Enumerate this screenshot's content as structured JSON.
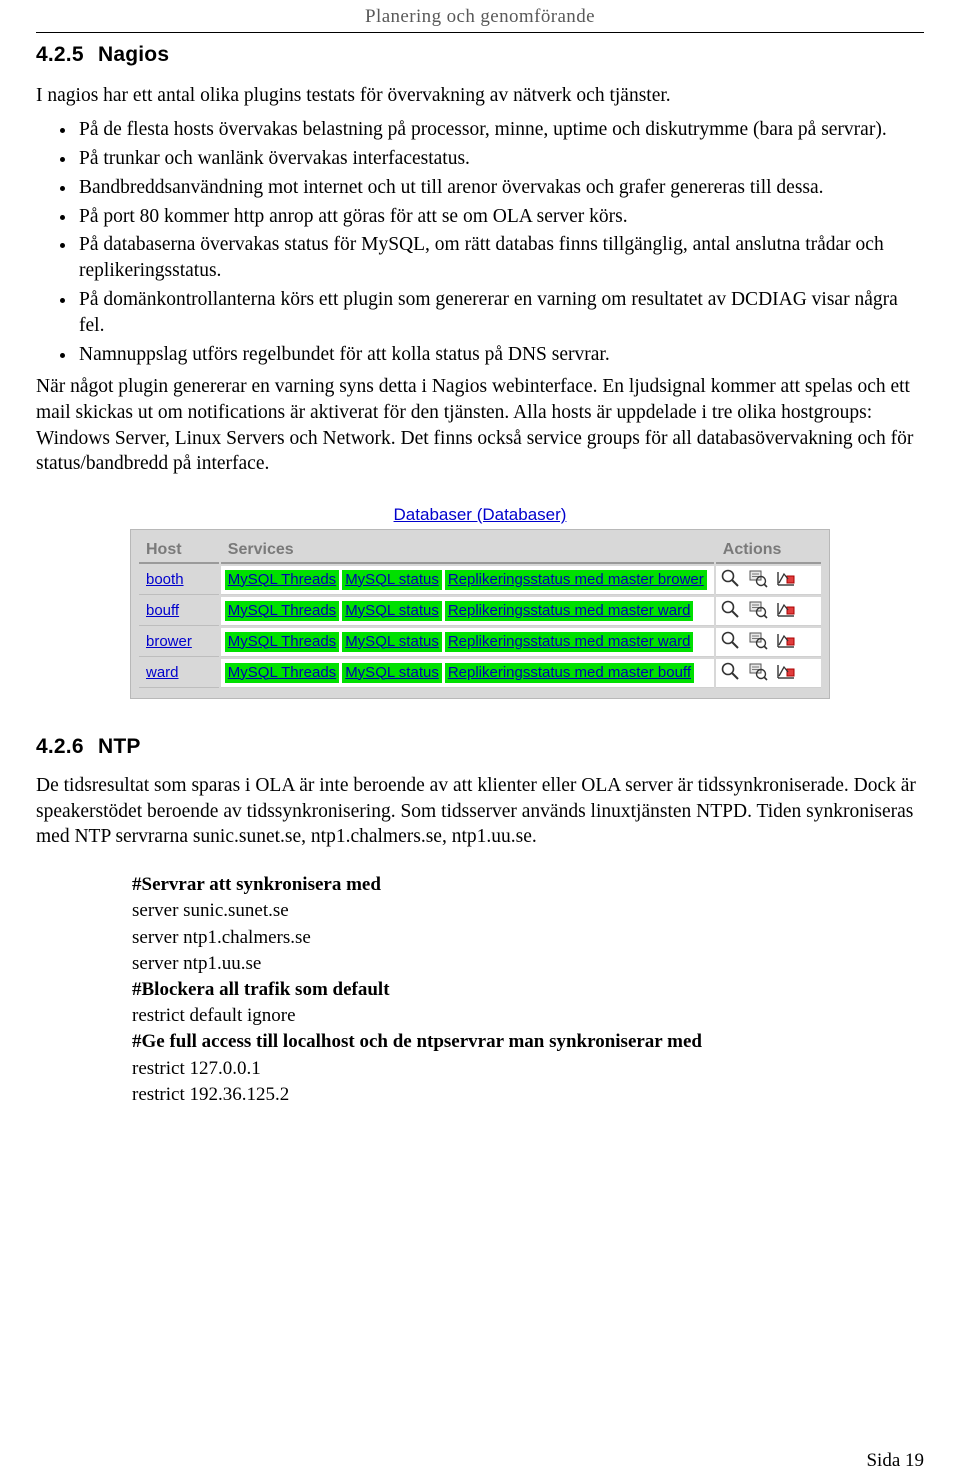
{
  "header": {
    "running_title": "Planering och genomförande"
  },
  "sections": {
    "nagios": {
      "number": "4.2.5",
      "title": "Nagios",
      "intro": "I nagios har ett antal olika plugins testats för övervakning av nätverk och tjänster.",
      "bullets": [
        "På de flesta hosts övervakas belastning på processor, minne, uptime och diskutrymme (bara på servrar).",
        "På trunkar och wanlänk övervakas interfacestatus.",
        "Bandbreddsanvändning mot internet och ut till arenor övervakas och grafer genereras till dessa.",
        "På port 80 kommer http anrop att göras för att se om OLA server körs.",
        "På databaserna övervakas status för MySQL, om rätt databas finns tillgänglig, antal anslutna trådar och replikeringsstatus.",
        "På domänkontrollanterna körs ett plugin som genererar en varning om resultatet av DCDIAG visar några fel.",
        "Namnuppslag utförs regelbundet för att kolla status på DNS servrar."
      ],
      "outro": "När något plugin genererar en varning syns detta i Nagios webinterface. En ljudsignal kommer att spelas och ett mail skickas ut om notifications är aktiverat för den tjänsten. Alla hosts är uppdelade i tre olika hostgroups: Windows Server, Linux Servers och Network. Det finns också service groups för all databasövervakning och för status/bandbredd på interface."
    },
    "ntp": {
      "number": "4.2.6",
      "title": "NTP",
      "paragraph": "De tidsresultat som sparas i OLA är inte beroende av att klienter eller OLA server är tidssynkroniserade. Dock är speakerstödet beroende av tidssynkronisering. Som tidsserver används linuxtjänsten NTPD. Tiden synkroniseras med NTP servrarna sunic.sunet.se, ntp1.chalmers.se, ntp1.uu.se.",
      "config": [
        {
          "text": "#Servrar att synkronisera med",
          "bold": true
        },
        {
          "text": "server sunic.sunet.se",
          "bold": false
        },
        {
          "text": "server ntp1.chalmers.se",
          "bold": false
        },
        {
          "text": "server ntp1.uu.se",
          "bold": false
        },
        {
          "text": "#Blockera all trafik som default",
          "bold": true
        },
        {
          "text": "restrict default ignore",
          "bold": false
        },
        {
          "text": "#Ge full access till localhost och de ntpservrar man synkroniserar med",
          "bold": true
        },
        {
          "text": "restrict 127.0.0.1",
          "bold": false
        },
        {
          "text": "restrict 192.36.125.2",
          "bold": false
        }
      ]
    }
  },
  "nagios_figure": {
    "title": "Databaser (Databaser)",
    "columns": [
      "Host",
      "Services",
      "Actions"
    ],
    "rows": [
      {
        "host": "booth",
        "services": [
          "MySQL Threads",
          "MySQL status",
          "Replikeringsstatus med master brower"
        ],
        "actions": [
          "magnifier-icon",
          "host-detail-icon",
          "trends-icon"
        ]
      },
      {
        "host": "bouff",
        "services": [
          "MySQL Threads",
          "MySQL status",
          "Replikeringsstatus med master ward"
        ],
        "actions": [
          "magnifier-icon",
          "host-detail-icon",
          "trends-icon"
        ]
      },
      {
        "host": "brower",
        "services": [
          "MySQL Threads",
          "MySQL status",
          "Replikeringsstatus med master ward"
        ],
        "actions": [
          "magnifier-icon",
          "host-detail-icon",
          "trends-icon"
        ]
      },
      {
        "host": "ward",
        "services": [
          "MySQL Threads",
          "MySQL status",
          "Replikeringsstatus med master bouff"
        ],
        "actions": [
          "magnifier-icon",
          "host-detail-icon",
          "trends-icon"
        ]
      }
    ],
    "colors": {
      "service_ok_bg": "#00e000",
      "link": "#0000cc",
      "panel_bg": "#d8d8d8"
    }
  },
  "footer": {
    "page_label": "Sida 19"
  }
}
